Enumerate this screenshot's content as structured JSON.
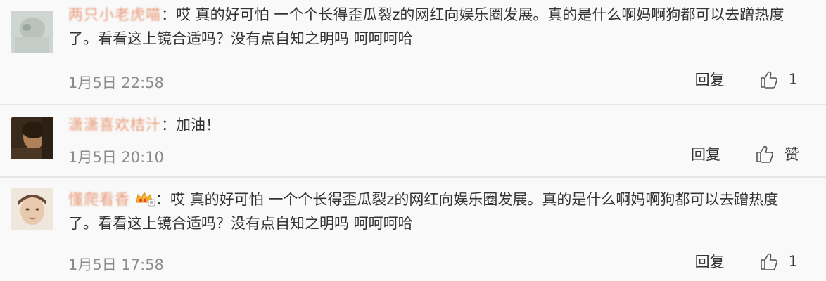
{
  "comments": [
    {
      "username": "两只小老虎喵",
      "separator": "：",
      "text": "哎 真的好可怕 一个个长得歪瓜裂z的网红向娱乐圈发展。真的是什么啊妈啊狗都可以去蹭热度了。看看这上镜合适吗？没有点自知之明吗 呵呵呵哈",
      "timestamp": "1月5日 22:58",
      "reply_label": "回复",
      "like_count": "1"
    },
    {
      "username": "潇潇喜欢桔汁",
      "separator": "：",
      "text": "加油！",
      "timestamp": "1月5日 20:10",
      "reply_label": "回复",
      "like_count": "赞"
    },
    {
      "username": "懂爬看香",
      "separator": "：",
      "text": "哎 真的好可怕 一个个长得歪瓜裂z的网红向娱乐圈发展。真的是什么啊妈啊狗都可以去蹭热度了。看看这上镜合适吗？没有点自知之明吗 呵呵呵哈",
      "timestamp": "1月5日 17:58",
      "reply_label": "回复",
      "like_count": "1"
    }
  ],
  "colors": {
    "background": "#f9f9f9",
    "username": "#e89a78",
    "text": "#333333",
    "meta": "#8c8c8c",
    "divider": "#e6e6e6"
  }
}
